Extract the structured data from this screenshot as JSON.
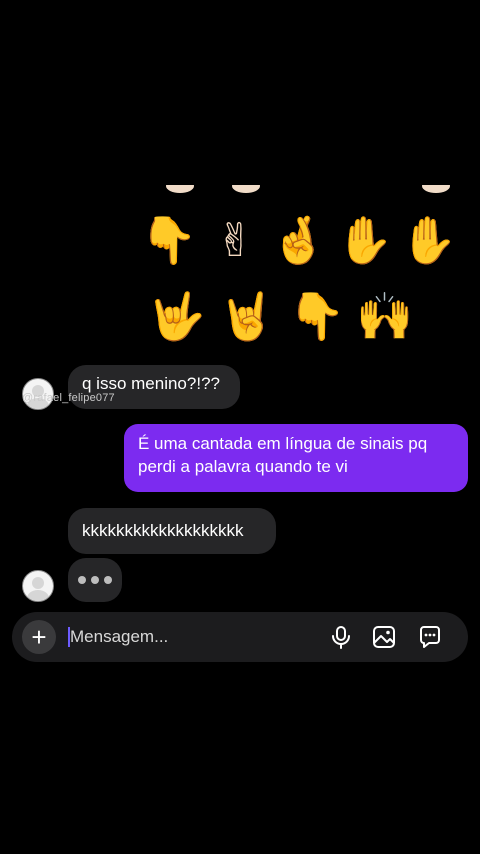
{
  "sticker": {
    "row1": [
      "👇",
      "✌",
      "🤞",
      "✋",
      "✋"
    ],
    "row2": [
      "🤟",
      "🤘",
      "👇",
      "🙌"
    ]
  },
  "thread": {
    "username": "@rafael_felipe077",
    "messages": [
      {
        "from": "them",
        "text": "q isso menino?!??"
      },
      {
        "from": "me",
        "text": "É uma cantada em língua de sinais pq perdi a palavra quando te vi"
      },
      {
        "from": "them",
        "text": "kkkkkkkkkkkkkkkkkkk"
      }
    ]
  },
  "composer": {
    "plus_label": "+",
    "placeholder": "Mensagem...",
    "icons": [
      "plus-icon",
      "microphone-icon",
      "image-icon",
      "sticker-icon"
    ]
  }
}
